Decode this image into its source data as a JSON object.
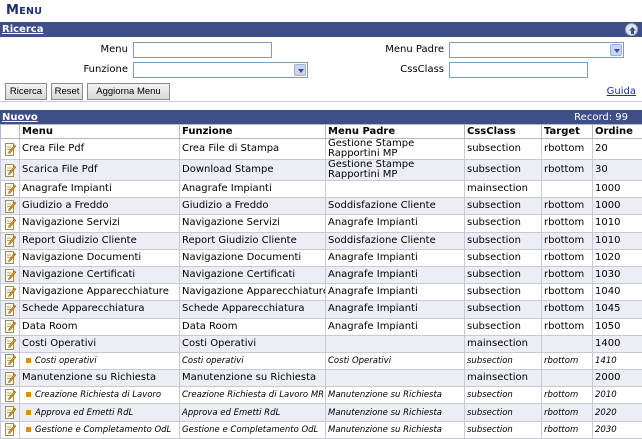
{
  "page": {
    "title_first": "M",
    "title_rest": "ENU"
  },
  "search": {
    "bar_label": "Ricerca",
    "menu_label": "Menu",
    "menu_value": "",
    "funzione_label": "Funzione",
    "funzione_value": "",
    "menu_padre_label": "Menu Padre",
    "menu_padre_value": "",
    "cssclass_label": "CssClass",
    "cssclass_value": "",
    "btn_ricerca": "Ricerca",
    "btn_reset": "Reset",
    "btn_aggiorna": "Aggiorna Menu",
    "guida": "Guida"
  },
  "list": {
    "nuovo": "Nuovo",
    "record": "Record: 99",
    "columns": [
      "Menu",
      "Funzione",
      "Menu Padre",
      "CssClass",
      "Target",
      "Ordine"
    ],
    "rows": [
      {
        "menu": "Crea File Pdf",
        "funzione": "Crea File di Stampa",
        "padre": "Gestione Stampe Rapportini MP",
        "css": "subsection",
        "target": "rbottom",
        "ordine": "20",
        "sub": false
      },
      {
        "menu": "Scarica File Pdf",
        "funzione": "Download Stampe",
        "padre": "Gestione Stampe Rapportini MP",
        "css": "subsection",
        "target": "rbottom",
        "ordine": "30",
        "sub": false
      },
      {
        "menu": "Anagrafe Impianti",
        "funzione": "Anagrafe Impianti",
        "padre": "",
        "css": "mainsection",
        "target": "",
        "ordine": "1000",
        "sub": false
      },
      {
        "menu": "Giudizio a Freddo",
        "funzione": "Giudizio a Freddo",
        "padre": "Soddisfazione Cliente",
        "css": "subsection",
        "target": "rbottom",
        "ordine": "1000",
        "sub": false
      },
      {
        "menu": "Navigazione Servizi",
        "funzione": "Navigazione Servizi",
        "padre": "Anagrafe Impianti",
        "css": "subsection",
        "target": "rbottom",
        "ordine": "1010",
        "sub": false
      },
      {
        "menu": "Report Giudizio Cliente",
        "funzione": "Report Giudizio Cliente",
        "padre": "Soddisfazione Cliente",
        "css": "subsection",
        "target": "rbottom",
        "ordine": "1010",
        "sub": false
      },
      {
        "menu": "Navigazione Documenti",
        "funzione": "Navigazione Documenti",
        "padre": "Anagrafe Impianti",
        "css": "subsection",
        "target": "rbottom",
        "ordine": "1020",
        "sub": false
      },
      {
        "menu": "Navigazione Certificati",
        "funzione": "Navigazione Certificati",
        "padre": "Anagrafe Impianti",
        "css": "subsection",
        "target": "rbottom",
        "ordine": "1030",
        "sub": false
      },
      {
        "menu": "Navigazione Apparecchiature",
        "funzione": "Navigazione Apparecchiature",
        "padre": "Anagrafe Impianti",
        "css": "subsection",
        "target": "rbottom",
        "ordine": "1040",
        "sub": false
      },
      {
        "menu": "Schede Apparecchiatura",
        "funzione": "Schede Apparecchiatura",
        "padre": "Anagrafe Impianti",
        "css": "subsection",
        "target": "rbottom",
        "ordine": "1045",
        "sub": false
      },
      {
        "menu": "Data Room",
        "funzione": "Data Room",
        "padre": "Anagrafe Impianti",
        "css": "subsection",
        "target": "rbottom",
        "ordine": "1050",
        "sub": false
      },
      {
        "menu": "Costi Operativi",
        "funzione": "Costi Operativi",
        "padre": "",
        "css": "mainsection",
        "target": "",
        "ordine": "1400",
        "sub": false
      },
      {
        "menu": "Costi operativi",
        "funzione": "Costi operativi",
        "padre": "Costi Operativi",
        "css": "subsection",
        "target": "rbottom",
        "ordine": "1410",
        "sub": true
      },
      {
        "menu": "Manutenzione su Richiesta",
        "funzione": "Manutenzione su Richiesta",
        "padre": "",
        "css": "mainsection",
        "target": "",
        "ordine": "2000",
        "sub": false
      },
      {
        "menu": "Creazione Richiesta di Lavoro",
        "funzione": "Creazione Richiesta di Lavoro MR",
        "padre": "Manutenzione su Richiesta",
        "css": "subsection",
        "target": "rbottom",
        "ordine": "2010",
        "sub": true
      },
      {
        "menu": "Approva ed Emetti RdL",
        "funzione": "Approva ed Emetti RdL",
        "padre": "Manutenzione su Richiesta",
        "css": "subsection",
        "target": "rbottom",
        "ordine": "2020",
        "sub": true
      },
      {
        "menu": "Gestione e Completamento OdL",
        "funzione": "Gestione e Completamento OdL",
        "padre": "Manutenzione su Richiesta",
        "css": "subsection",
        "target": "rbottom",
        "ordine": "2030",
        "sub": true
      }
    ]
  },
  "colors": {
    "bar": "#3e4e86",
    "title": "#1f2d6e",
    "bullet": "#e08a10"
  }
}
